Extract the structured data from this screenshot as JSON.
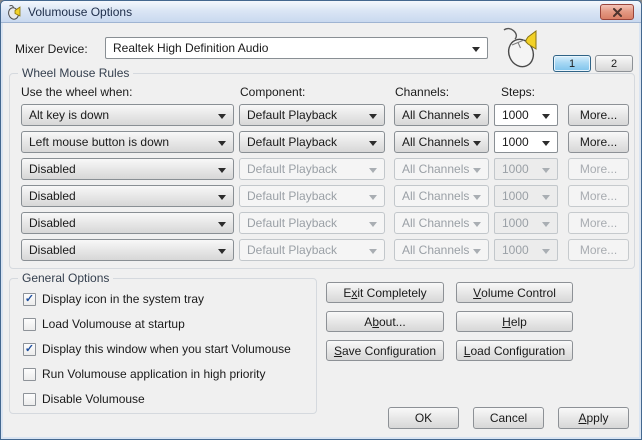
{
  "window": {
    "title": "Volumouse Options"
  },
  "mixer": {
    "label": "Mixer Device:",
    "value": "Realtek High Definition Audio"
  },
  "tabs": {
    "tab1": "1",
    "tab2": "2"
  },
  "rules": {
    "caption": "Wheel Mouse Rules",
    "headers": {
      "when": "Use the wheel when:",
      "component": "Component:",
      "channels": "Channels:",
      "steps": "Steps:"
    },
    "more_label": "More...",
    "rows": [
      {
        "when": "Alt key is down",
        "component": "Default Playback",
        "channels": "All Channels",
        "steps": "1000",
        "enabled": true
      },
      {
        "when": "Left mouse button is down",
        "component": "Default Playback",
        "channels": "All Channels",
        "steps": "1000",
        "enabled": true
      },
      {
        "when": "Disabled",
        "component": "Default Playback",
        "channels": "All Channels",
        "steps": "1000",
        "enabled": false
      },
      {
        "when": "Disabled",
        "component": "Default Playback",
        "channels": "All Channels",
        "steps": "1000",
        "enabled": false
      },
      {
        "when": "Disabled",
        "component": "Default Playback",
        "channels": "All Channels",
        "steps": "1000",
        "enabled": false
      },
      {
        "when": "Disabled",
        "component": "Default Playback",
        "channels": "All Channels",
        "steps": "1000",
        "enabled": false
      }
    ]
  },
  "general": {
    "caption": "General Options",
    "options": [
      {
        "label": "Display icon in the system tray",
        "checked": true,
        "mark": "✓"
      },
      {
        "label": "Load Volumouse at startup",
        "checked": false,
        "mark": ""
      },
      {
        "label": "Display this window when you start Volumouse",
        "checked": true,
        "mark": "✓"
      },
      {
        "label": "Run Volumouse application in high priority",
        "checked": false,
        "mark": ""
      },
      {
        "label": "Disable Volumouse",
        "checked": false,
        "mark": ""
      }
    ]
  },
  "actions": {
    "exit": {
      "pre": "E",
      "key": "x",
      "post": "it Completely"
    },
    "volume": {
      "pre": "",
      "key": "V",
      "post": "olume Control"
    },
    "about": {
      "pre": "A",
      "key": "b",
      "post": "out..."
    },
    "help": {
      "pre": "",
      "key": "H",
      "post": "elp"
    },
    "save": {
      "pre": "",
      "key": "S",
      "post": "ave Configuration"
    },
    "load": {
      "pre": "",
      "key": "L",
      "post": "oad Configuration"
    }
  },
  "footer": {
    "ok": {
      "pre": "OK",
      "key": "",
      "post": ""
    },
    "cancel": {
      "pre": "Cancel",
      "key": "",
      "post": ""
    },
    "apply": {
      "pre": "",
      "key": "A",
      "post": "pply"
    }
  },
  "icons": {
    "title": "volumouse-mouse-speaker-icon",
    "mouse": "mouse-with-speaker-icon",
    "close": "close-icon"
  },
  "colors": {
    "titlebar_top": "#f4f8fd",
    "titlebar_bottom": "#c9d9ef",
    "window_border": "#44688f",
    "close_button": "#d97f66",
    "tab_active": "#7fc3ec",
    "checkmark": "#1e4e9e",
    "speaker_yellow": "#f2d126"
  }
}
